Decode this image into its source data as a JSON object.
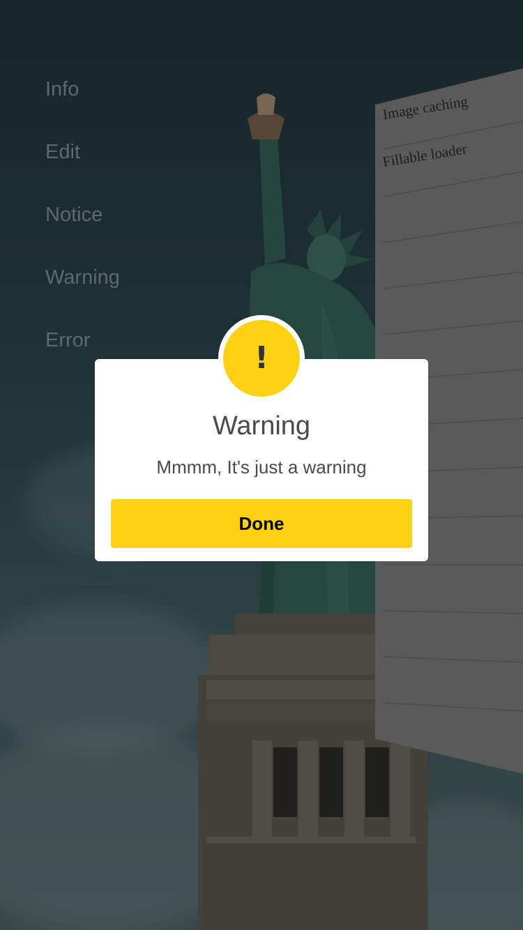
{
  "menu": {
    "items": [
      {
        "label": "Info"
      },
      {
        "label": "Edit"
      },
      {
        "label": "Notice"
      },
      {
        "label": "Warning"
      },
      {
        "label": "Error"
      }
    ]
  },
  "side_panel": {
    "rows": [
      {
        "label": "Image caching"
      },
      {
        "label": "Fillable loader"
      }
    ]
  },
  "dialog": {
    "icon": "exclamation-icon",
    "icon_glyph": "!",
    "title": "Warning",
    "message": "Mmmm, It's just a warning",
    "button_label": "Done",
    "accent_color": "#fed115"
  }
}
